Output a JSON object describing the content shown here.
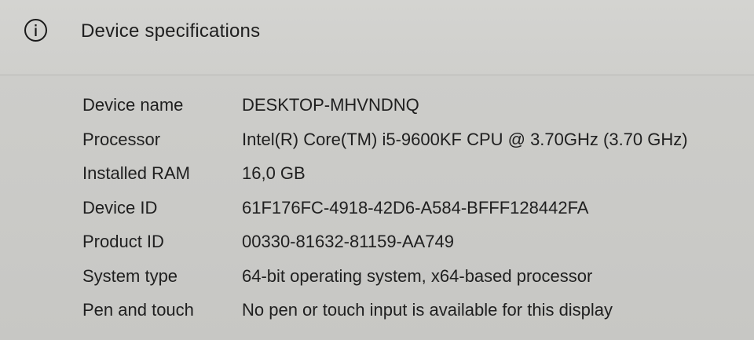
{
  "header": {
    "title": "Device specifications",
    "icon": "info-icon"
  },
  "specs": [
    {
      "label": "Device name",
      "value": "DESKTOP-MHVNDNQ"
    },
    {
      "label": "Processor",
      "value": "Intel(R) Core(TM) i5-9600KF CPU @ 3.70GHz (3.70 GHz)"
    },
    {
      "label": "Installed RAM",
      "value": "16,0 GB"
    },
    {
      "label": "Device ID",
      "value": "61F176FC-4918-42D6-A584-BFFF128442FA"
    },
    {
      "label": "Product ID",
      "value": "00330-81632-81159-AA749"
    },
    {
      "label": "System type",
      "value": "64-bit operating system, x64-based processor"
    },
    {
      "label": "Pen and touch",
      "value": "No pen or touch input is available for this display"
    }
  ]
}
